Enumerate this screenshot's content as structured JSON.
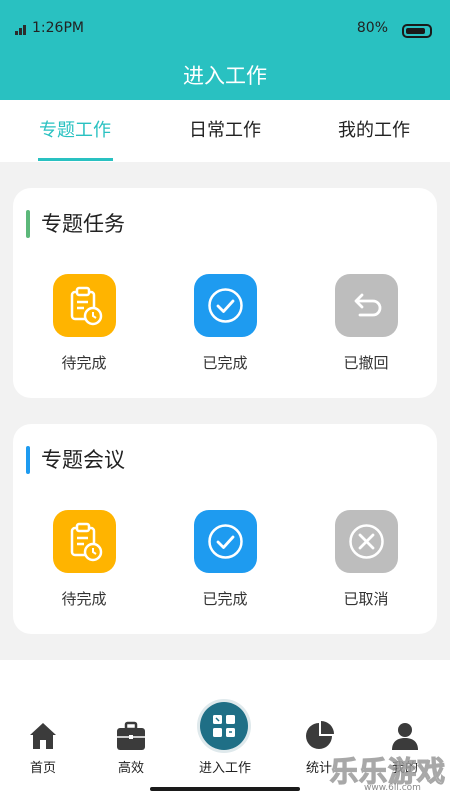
{
  "status_bar": {
    "time": "1:26PM",
    "battery": "80%"
  },
  "header": {
    "title": "进入工作"
  },
  "tabs": [
    {
      "label": "专题工作",
      "active": true
    },
    {
      "label": "日常工作",
      "active": false
    },
    {
      "label": "我的工作",
      "active": false
    }
  ],
  "cards": [
    {
      "title": "专题任务",
      "accent": "#5cb87a",
      "items": [
        {
          "label": "待完成",
          "icon": "clipboard-clock-icon",
          "color": "#ffb400"
        },
        {
          "label": "已完成",
          "icon": "check-circle-icon",
          "color": "#1e9bf0"
        },
        {
          "label": "已撤回",
          "icon": "undo-arrow-icon",
          "color": "#bdbdbd"
        }
      ]
    },
    {
      "title": "专题会议",
      "accent": "#1e9bf0",
      "items": [
        {
          "label": "待完成",
          "icon": "clipboard-clock-icon",
          "color": "#ffb400"
        },
        {
          "label": "已完成",
          "icon": "check-circle-icon",
          "color": "#1e9bf0"
        },
        {
          "label": "已取消",
          "icon": "close-circle-icon",
          "color": "#bdbdbd"
        }
      ]
    }
  ],
  "bottom_nav": [
    {
      "label": "首页",
      "icon": "home-icon"
    },
    {
      "label": "高效",
      "icon": "briefcase-icon"
    },
    {
      "label": "进入工作",
      "icon": "work-hub-icon"
    },
    {
      "label": "统计",
      "icon": "pie-chart-icon"
    },
    {
      "label": "我的",
      "icon": "user-icon"
    }
  ],
  "watermark": {
    "text": "乐乐游戏",
    "site": "www.6ll.com"
  },
  "colors": {
    "primary": "#29c1c1",
    "yellow": "#ffb400",
    "blue": "#1e9bf0",
    "grey": "#bdbdbd"
  }
}
